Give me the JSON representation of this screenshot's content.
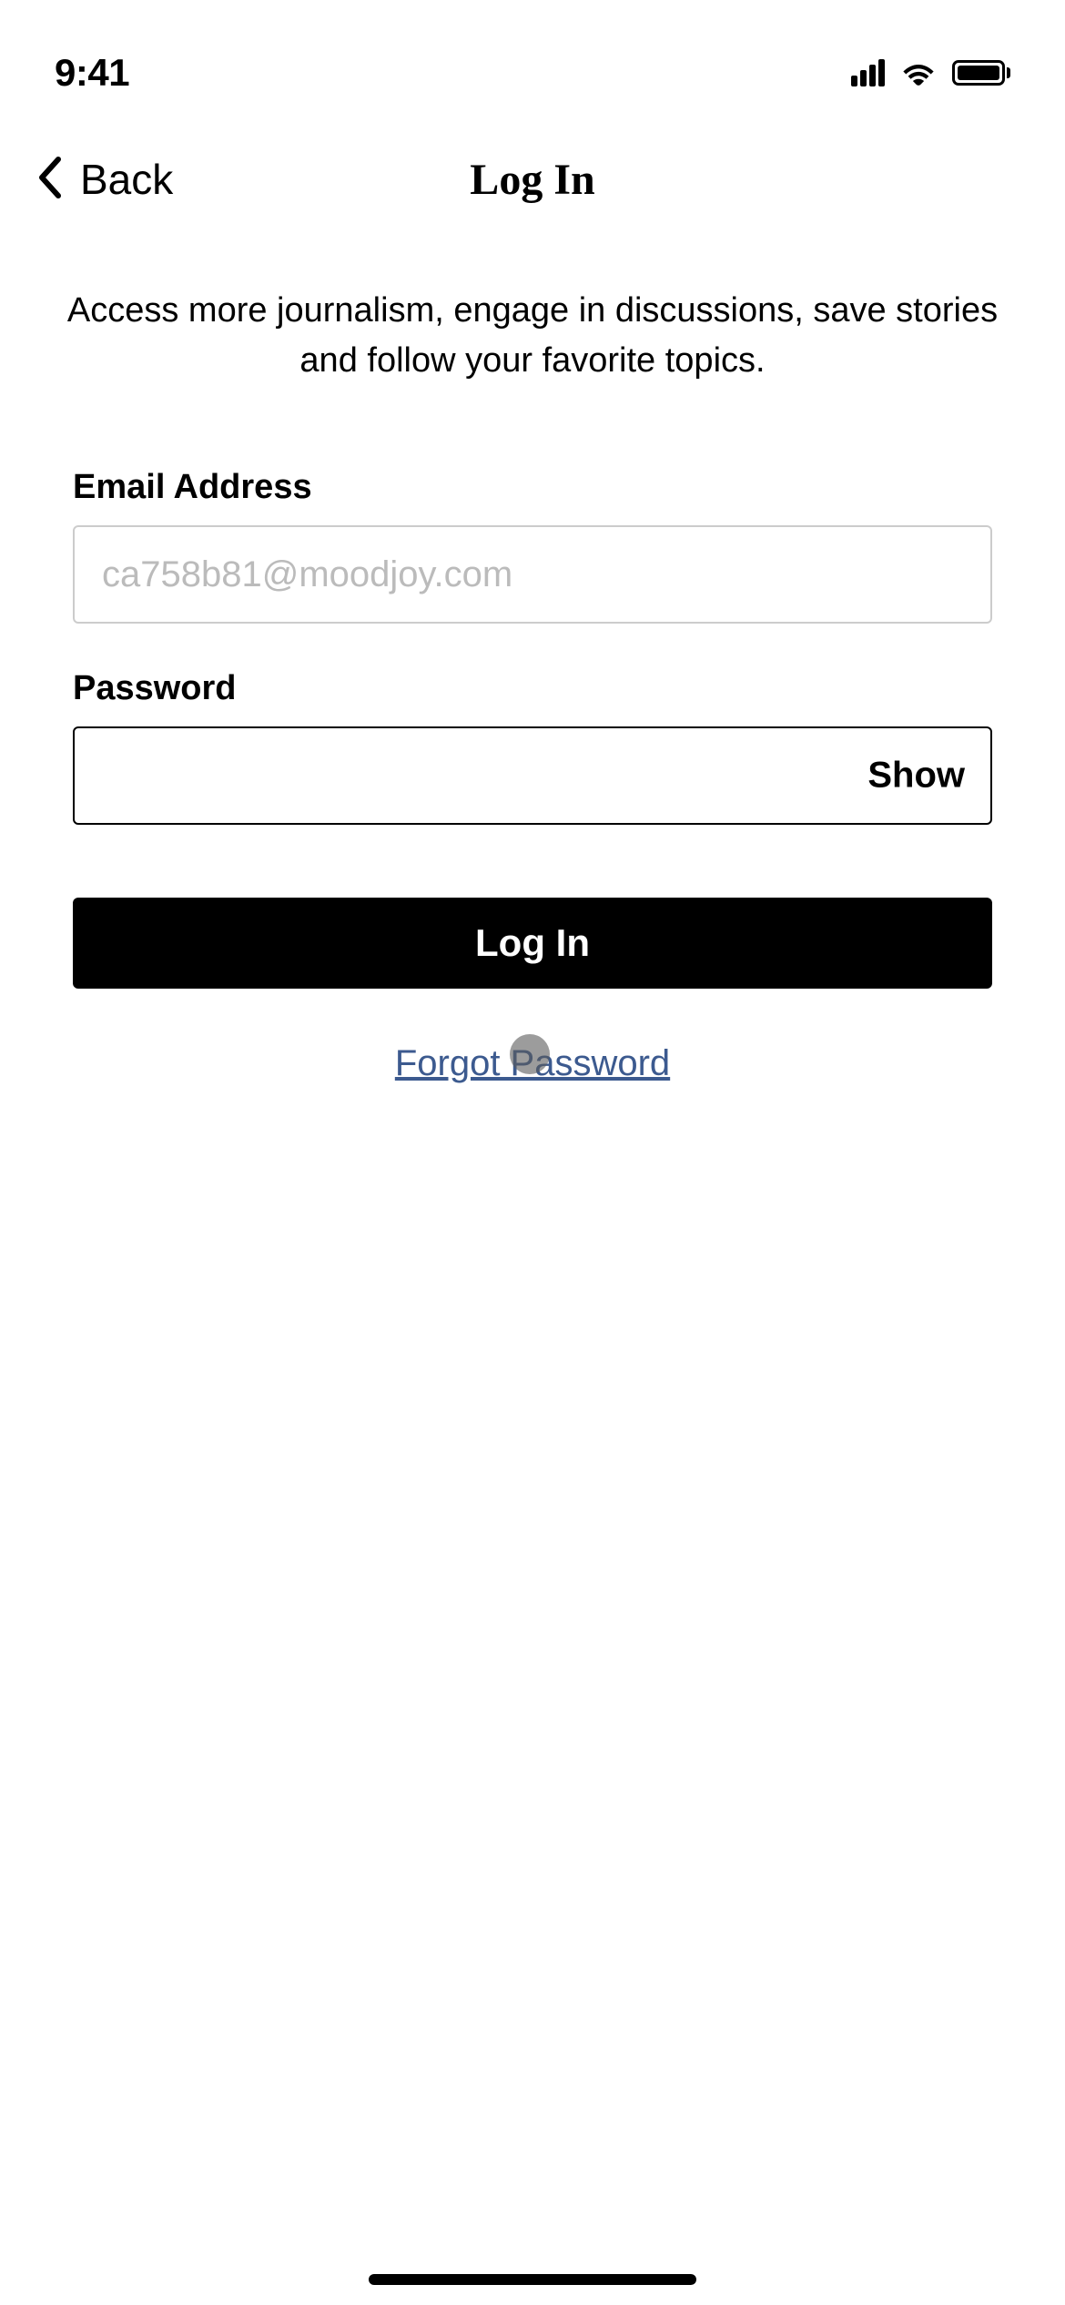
{
  "status_bar": {
    "time": "9:41"
  },
  "nav": {
    "back_label": "Back",
    "title": "Log In"
  },
  "subtitle": "Access more journalism, engage in discussions, save stories and follow your favorite topics.",
  "form": {
    "email_label": "Email Address",
    "email_value": "ca758b81@moodjoy.com",
    "password_label": "Password",
    "password_value": "",
    "show_label": "Show",
    "login_button": "Log In",
    "forgot_link": "Forgot Password"
  }
}
